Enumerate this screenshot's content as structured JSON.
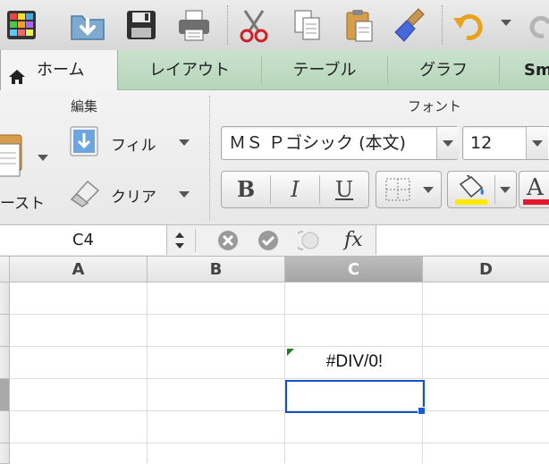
{
  "toolbar": {
    "icons": [
      "gallery-icon",
      "open-folder-icon",
      "save-icon",
      "print-icon",
      "cut-icon",
      "copy-icon",
      "paste-icon",
      "format-painter-icon",
      "undo-icon",
      "redo-icon"
    ]
  },
  "tabs": [
    {
      "label": "ホーム",
      "active": true
    },
    {
      "label": "レイアウト"
    },
    {
      "label": "テーブル"
    },
    {
      "label": "グラフ"
    },
    {
      "label": "Sm"
    }
  ],
  "ribbon": {
    "edit_group_label": "編集",
    "font_group_label": "フォント",
    "paste_label": "ースト",
    "fill_label": "フィル",
    "clear_label": "クリア",
    "font_name": "ＭＳ Ｐゴシック (本文)",
    "font_size": "12",
    "bold_label": "B",
    "italic_label": "I",
    "underline_label": "U",
    "font_color_label": "A",
    "colors": {
      "highlight": "#ffe800",
      "font_color": "#e8162c"
    }
  },
  "formula_bar": {
    "name_box": "C4",
    "fx_label": "fx",
    "formula": ""
  },
  "grid": {
    "columns": [
      "A",
      "B",
      "C",
      "D"
    ],
    "selected_column": "C",
    "selected_cell": "C4",
    "cells": {
      "C3": "#DIV/0!"
    }
  }
}
